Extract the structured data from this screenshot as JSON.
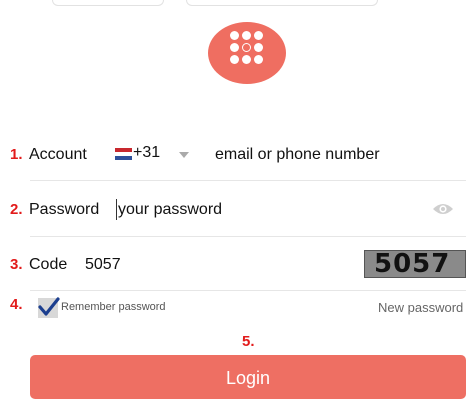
{
  "steps": [
    "1.",
    "2.",
    "3.",
    "4.",
    "5."
  ],
  "account": {
    "label": "Account",
    "country_code": "+31",
    "placeholder": "email or phone number"
  },
  "password": {
    "label": "Password",
    "placeholder": "your password"
  },
  "code": {
    "label": "Code",
    "value": "5057",
    "captcha_text": "5057"
  },
  "options": {
    "remember_label": "Remember password",
    "remember_checked": true,
    "new_password": "New password"
  },
  "login": {
    "label": "Login"
  },
  "colors": {
    "accent": "#ee6f63",
    "step_red": "#e21b1b"
  },
  "icons": {
    "logo": "grid-dots-icon",
    "flag": "netherlands-flag-icon",
    "dropdown": "caret-down-icon",
    "visibility": "eye-icon",
    "check": "checkmark-icon"
  }
}
